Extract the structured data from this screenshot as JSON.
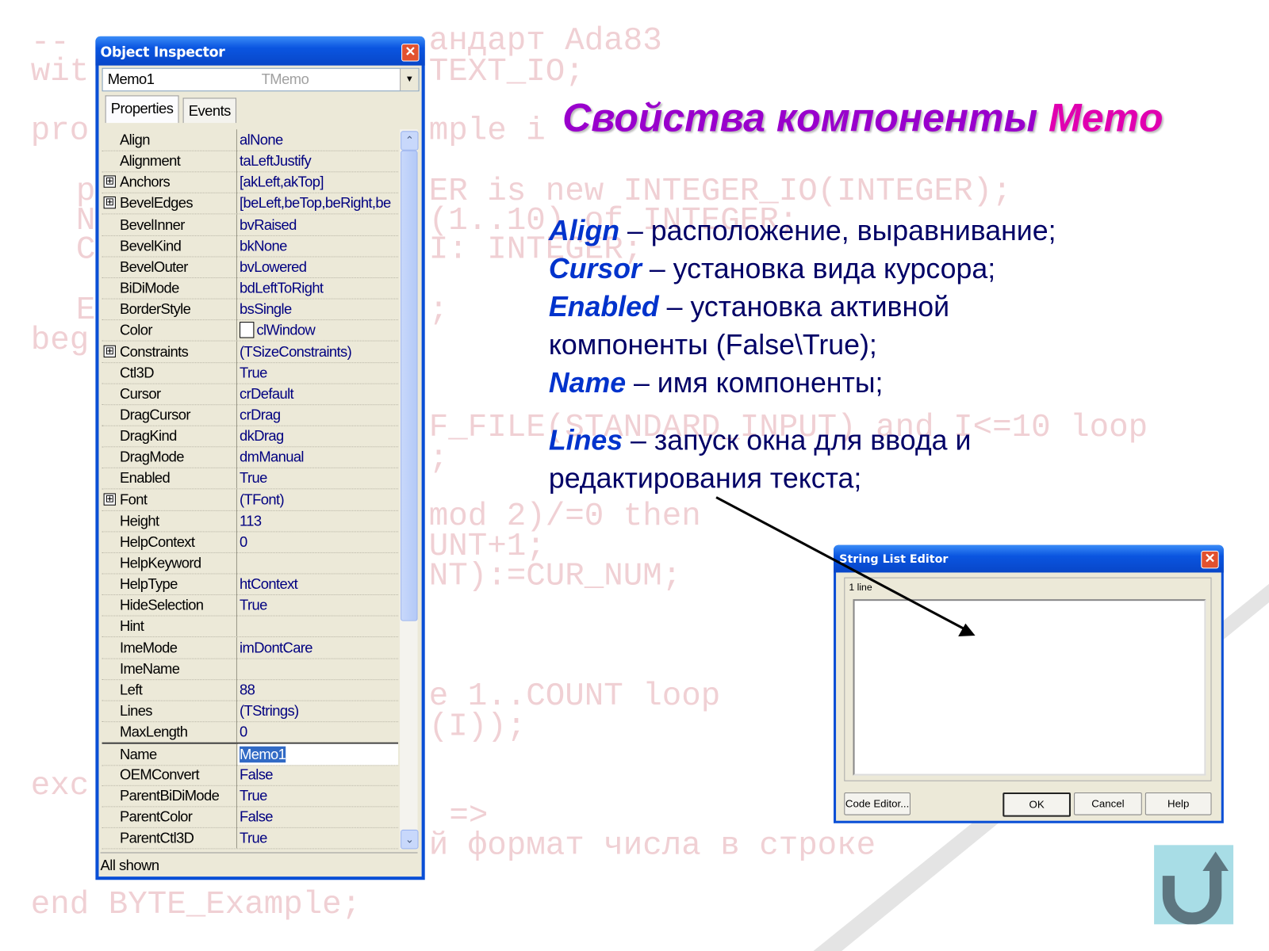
{
  "background_code": [
    "-- ",
    "андарт Ada83",
    "wit",
    "TEXT_IO;",
    "pro",
    "mple i",
    "p",
    "ER is new INTEGER_IO(INTEGER);",
    "N",
    "(1..10) of INTEGER;",
    "C",
    "I: INTEGER;",
    "E",
    ";",
    "beg",
    "F_FILE(STANDARD_INPUT) and I<=10 loop",
    ";",
    "mod 2)/=0 then",
    "UNT+1;",
    "NT):=CUR_NUM;",
    "e 1..COUNT loop",
    "(I));",
    "exc",
    "=>",
    "й формат числа в строке",
    "end BYTE_Example;"
  ],
  "object_inspector": {
    "title": "Object Inspector",
    "selected_object": "Memo1",
    "selected_type": "TMemo",
    "tabs": [
      "Properties",
      "Events"
    ],
    "active_tab": "Properties",
    "properties": [
      {
        "name": "Align",
        "value": "alNone"
      },
      {
        "name": "Alignment",
        "value": "taLeftJustify"
      },
      {
        "name": "Anchors",
        "value": "[akLeft,akTop]",
        "expandable": true
      },
      {
        "name": "BevelEdges",
        "value": "[beLeft,beTop,beRight,be",
        "expandable": true
      },
      {
        "name": "BevelInner",
        "value": "bvRaised"
      },
      {
        "name": "BevelKind",
        "value": "bkNone"
      },
      {
        "name": "BevelOuter",
        "value": "bvLowered"
      },
      {
        "name": "BiDiMode",
        "value": "bdLeftToRight"
      },
      {
        "name": "BorderStyle",
        "value": "bsSingle"
      },
      {
        "name": "Color",
        "value": "clWindow",
        "swatch": "#ffffff"
      },
      {
        "name": "Constraints",
        "value": "(TSizeConstraints)",
        "expandable": true
      },
      {
        "name": "Ctl3D",
        "value": "True"
      },
      {
        "name": "Cursor",
        "value": "crDefault"
      },
      {
        "name": "DragCursor",
        "value": "crDrag"
      },
      {
        "name": "DragKind",
        "value": "dkDrag"
      },
      {
        "name": "DragMode",
        "value": "dmManual"
      },
      {
        "name": "Enabled",
        "value": "True"
      },
      {
        "name": "Font",
        "value": "(TFont)",
        "expandable": true
      },
      {
        "name": "Height",
        "value": "113"
      },
      {
        "name": "HelpContext",
        "value": "0"
      },
      {
        "name": "HelpKeyword",
        "value": ""
      },
      {
        "name": "HelpType",
        "value": "htContext"
      },
      {
        "name": "HideSelection",
        "value": "True"
      },
      {
        "name": "Hint",
        "value": ""
      },
      {
        "name": "ImeMode",
        "value": "imDontCare"
      },
      {
        "name": "ImeName",
        "value": ""
      },
      {
        "name": "Left",
        "value": "88"
      },
      {
        "name": "Lines",
        "value": "(TStrings)"
      },
      {
        "name": "MaxLength",
        "value": "0"
      },
      {
        "name": "Name",
        "value": "Memo1",
        "selected": true
      },
      {
        "name": "OEMConvert",
        "value": "False"
      },
      {
        "name": "ParentBiDiMode",
        "value": "True"
      },
      {
        "name": "ParentColor",
        "value": "False"
      },
      {
        "name": "ParentCtl3D",
        "value": "True"
      }
    ],
    "status": "All shown",
    "expand_glyph": "⊞"
  },
  "slide": {
    "title_main": "Свойства компоненты ",
    "title_accent": "Memo",
    "items": [
      {
        "term": "Align",
        "text": " – расположение, выравнивание;"
      },
      {
        "term": "Cursor",
        "text": " – установка вида курсора;"
      },
      {
        "term": "Enabled",
        "text": " – установка активной"
      },
      {
        "term": "",
        "text": "компоненты (False\\True);"
      },
      {
        "term": "Name",
        "text": " – имя компоненты;"
      },
      {
        "term": "Lines",
        "text": " – запуск окна для ввода и"
      },
      {
        "term": "",
        "text": "редактирования текста;"
      }
    ],
    "colors": {
      "title": "#9900cc",
      "accent": "#e000b0",
      "term": "#0033cc",
      "text": "#000066",
      "code": "#f0d0d4"
    }
  },
  "string_list_editor": {
    "title": "String List Editor",
    "line_count": "1 line",
    "buttons": {
      "code_editor": "Code Editor...",
      "ok": "OK",
      "cancel": "Cancel",
      "help": "Help"
    }
  },
  "return_button": {
    "icon": "return-arrow-icon"
  }
}
